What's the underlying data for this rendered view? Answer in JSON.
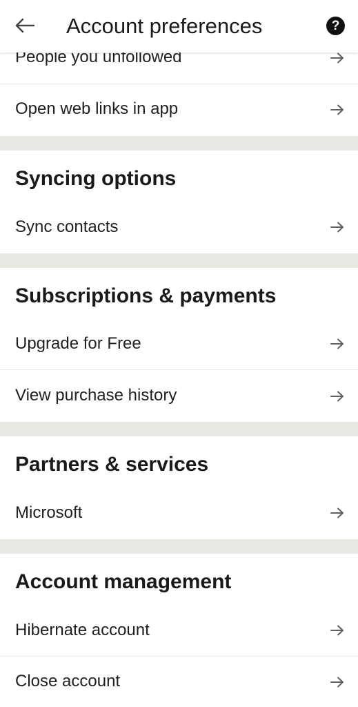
{
  "header": {
    "title": "Account preferences",
    "help_label": "?"
  },
  "rows": {
    "people_unfollowed": "People you unfollowed",
    "open_web_links": "Open web links in app",
    "sync_contacts": "Sync contacts",
    "upgrade": "Upgrade for Free",
    "purchase_history": "View purchase history",
    "microsoft": "Microsoft",
    "hibernate": "Hibernate account",
    "close_account": "Close account"
  },
  "sections": {
    "syncing": "Syncing options",
    "subscriptions": "Subscriptions & payments",
    "partners": "Partners & services",
    "account_management": "Account management"
  },
  "colors": {
    "section_gap": "#e9e7e1",
    "text": "#1f1f1f",
    "arrow": "#5f5f5f"
  },
  "icons": {
    "back": "back-arrow-icon",
    "help": "help-icon",
    "row_arrow": "arrow-right-icon"
  }
}
